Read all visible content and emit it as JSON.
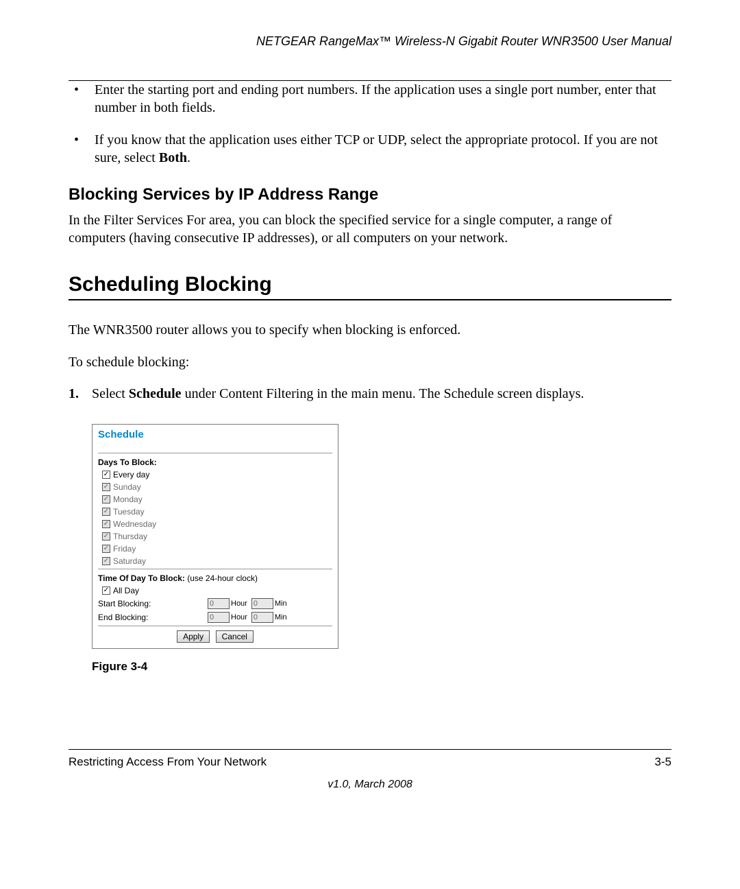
{
  "header": {
    "title": "NETGEAR RangeMax™ Wireless-N Gigabit Router WNR3500 User Manual"
  },
  "bullets": [
    {
      "text": "Enter the starting port and ending port numbers. If the application uses a single port number, enter that number in both fields."
    },
    {
      "prefix": "If you know that the application uses either TCP or UDP, select the appropriate protocol. If you are not sure, select ",
      "bold": "Both",
      "suffix": "."
    }
  ],
  "subheading": "Blocking Services by IP Address Range",
  "sub_paragraph": "In the Filter Services For area, you can block the specified service for a single computer, a range of computers (having consecutive IP addresses), or all computers on your network.",
  "section_heading": "Scheduling Blocking",
  "para1": "The WNR3500 router allows you to specify when blocking is enforced.",
  "para2": "To schedule blocking:",
  "step1": {
    "num": "1.",
    "prefix": "Select ",
    "bold": "Schedule",
    "suffix": " under Content Filtering in the main menu. The Schedule screen displays."
  },
  "panel": {
    "title": "Schedule",
    "days_label": "Days To Block:",
    "days": [
      {
        "label": "Every day",
        "checked": true,
        "enabled": true
      },
      {
        "label": "Sunday",
        "checked": true,
        "enabled": false
      },
      {
        "label": "Monday",
        "checked": true,
        "enabled": false
      },
      {
        "label": "Tuesday",
        "checked": true,
        "enabled": false
      },
      {
        "label": "Wednesday",
        "checked": true,
        "enabled": false
      },
      {
        "label": "Thursday",
        "checked": true,
        "enabled": false
      },
      {
        "label": "Friday",
        "checked": true,
        "enabled": false
      },
      {
        "label": "Saturday",
        "checked": true,
        "enabled": false
      }
    ],
    "time_label": "Time Of Day To Block:",
    "time_note": " (use 24-hour clock)",
    "all_day": {
      "label": "All Day",
      "checked": true
    },
    "start_label": "Start Blocking:",
    "end_label": "End Blocking:",
    "hour_unit": "Hour",
    "min_unit": "Min",
    "start_hour": "0",
    "start_min": "0",
    "end_hour": "0",
    "end_min": "0",
    "apply": "Apply",
    "cancel": "Cancel"
  },
  "figure_caption": "Figure 3-4",
  "footer": {
    "left": "Restricting Access From Your Network",
    "right": "3-5",
    "version": "v1.0, March 2008"
  }
}
